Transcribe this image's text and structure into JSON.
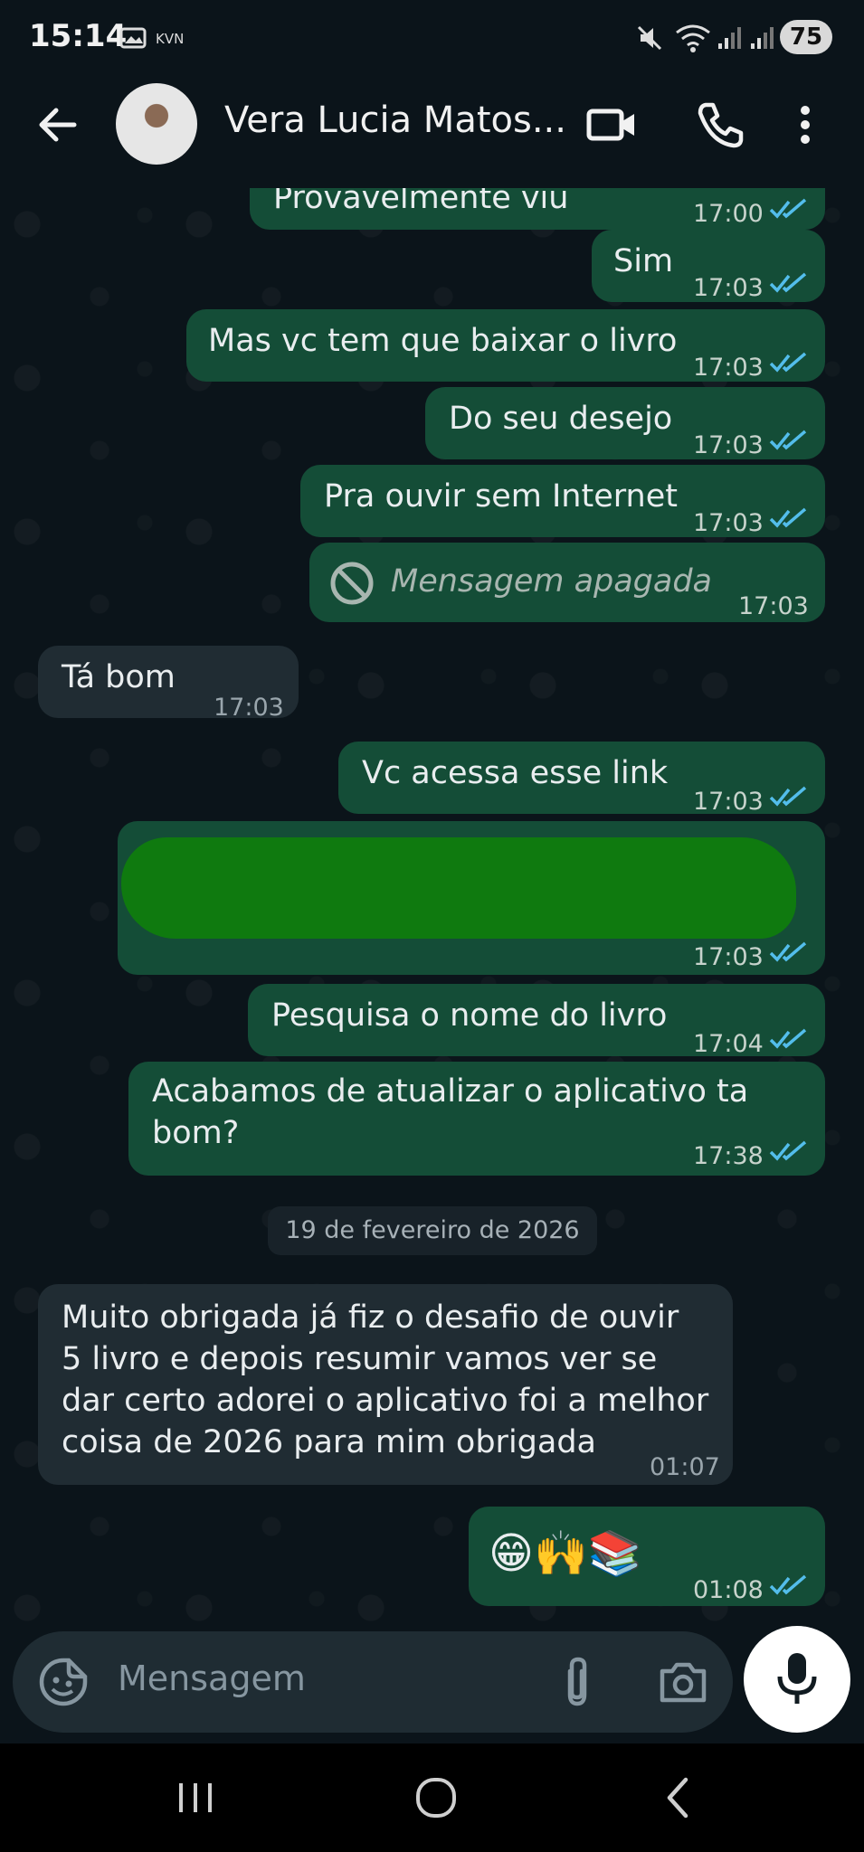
{
  "status": {
    "time": "15:14",
    "operator": "KVN",
    "battery": "75"
  },
  "header": {
    "contact_name": "Vera Lucia Matos..."
  },
  "messages": [
    {
      "text": "Provavelmente viu",
      "time": "17:00"
    },
    {
      "text": "Sim",
      "time": "17:03"
    },
    {
      "text": "Mas vc tem que baixar o livro",
      "time": "17:03"
    },
    {
      "text": "Do seu desejo",
      "time": "17:03"
    },
    {
      "text": "Pra ouvir sem Internet",
      "time": "17:03"
    },
    {
      "text": "Mensagem apagada",
      "time": "17:03"
    },
    {
      "text": "Tá bom",
      "time": "17:03"
    },
    {
      "text": "Vc acessa esse link",
      "time": "17:03"
    },
    {
      "text": "",
      "time": "17:03"
    },
    {
      "text": "Pesquisa o nome do livro",
      "time": "17:04"
    },
    {
      "line1": "Acabamos de atualizar o aplicativo ta",
      "line2": "bom?",
      "time": "17:38"
    },
    {
      "line1": "Muito obrigada já fiz o desafio de ouvir",
      "line2": "5 livro e depois resumir vamos ver se",
      "line3": "dar certo adorei o aplicativo foi a melhor",
      "line4": "coisa de 2026 para mim obrigada",
      "time": "01:07"
    },
    {
      "text": "😁🙌📚",
      "time": "01:08"
    }
  ],
  "date_divider": "19 de fevereiro de 2026",
  "input": {
    "placeholder": "Mensagem"
  },
  "colors": {
    "outgoing_bubble": "#144d37",
    "incoming_bubble": "#202c33",
    "read_ticks": "#53bdeb",
    "background": "#0b141a"
  }
}
